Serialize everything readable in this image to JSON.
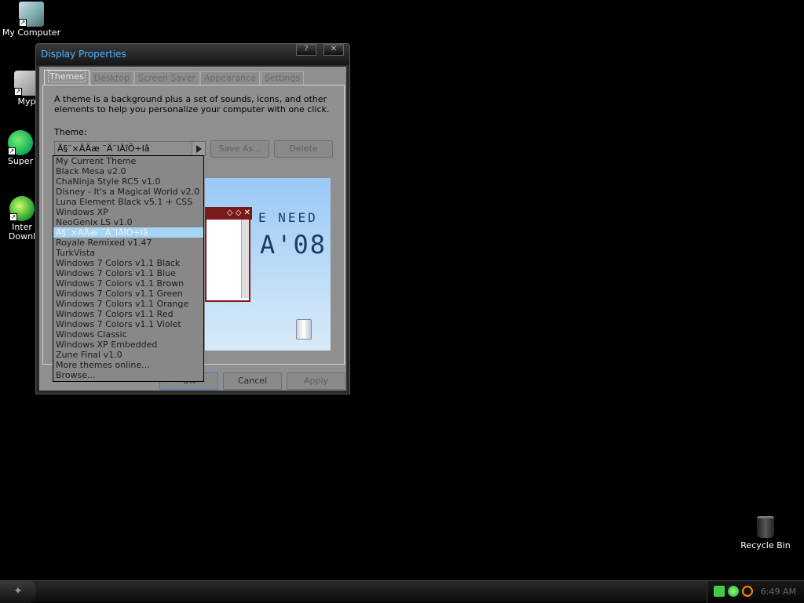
{
  "desktop": {
    "icons": [
      {
        "label": "My Computer"
      },
      {
        "label": "Myp"
      },
      {
        "label": "Super"
      },
      {
        "label": "Inter\nDownl"
      }
    ],
    "recycle_bin": "Recycle Bin"
  },
  "window": {
    "title": "Display Properties",
    "help_btn": "?",
    "close_btn": "✕",
    "tabs": [
      "Themes",
      "Desktop",
      "Screen Saver",
      "Appearance",
      "Settings"
    ],
    "description": "A theme is a background plus a set of sounds, icons, and other elements to help you personalize your computer with one click.",
    "theme_label": "Theme:",
    "combo_value": "Ä§¨×ÄÄæ ¨Ä¨IÄîÖ÷Iâ",
    "save_as": "Save As...",
    "delete": "Delete",
    "preview": {
      "line1": "E NEED",
      "line2": "A'08",
      "window_buttons": "◇ ◇ ✕"
    },
    "ok": "OK",
    "cancel": "Cancel",
    "apply": "Apply"
  },
  "dropdown": {
    "items": [
      "My Current Theme",
      "Black Mesa v2.0",
      "ChaNinja Style RC5 v1.0",
      "Disney - It's a Magical World v2.0",
      "Luna Element Black v5.1 + CSS",
      "Windows XP",
      "NeoGenix LS v1.0",
      "Ä§¨×ÄÄæ ¨Ä¨IÄîÖ÷Iâ",
      "Royale Remixed v1.47",
      "TurkVista",
      "Windows 7 Colors v1.1 Black",
      "Windows 7 Colors v1.1 Blue",
      "Windows 7 Colors v1.1 Brown",
      "Windows 7 Colors v1.1 Green",
      "Windows 7 Colors v1.1 Orange",
      "Windows 7 Colors v1.1 Red",
      "Windows 7 Colors v1.1 Violet",
      "Windows Classic",
      "Windows XP Embedded",
      "Zune Final v1.0",
      "More themes online...",
      "Browse..."
    ],
    "selected_index": 7
  },
  "taskbar": {
    "start_icon": "start-orb-icon",
    "clock": "6:49 AM"
  },
  "colors": {
    "title_text": "#4fb2ff",
    "selection": "#a6d4f5",
    "desktop_bg": "#000000"
  }
}
